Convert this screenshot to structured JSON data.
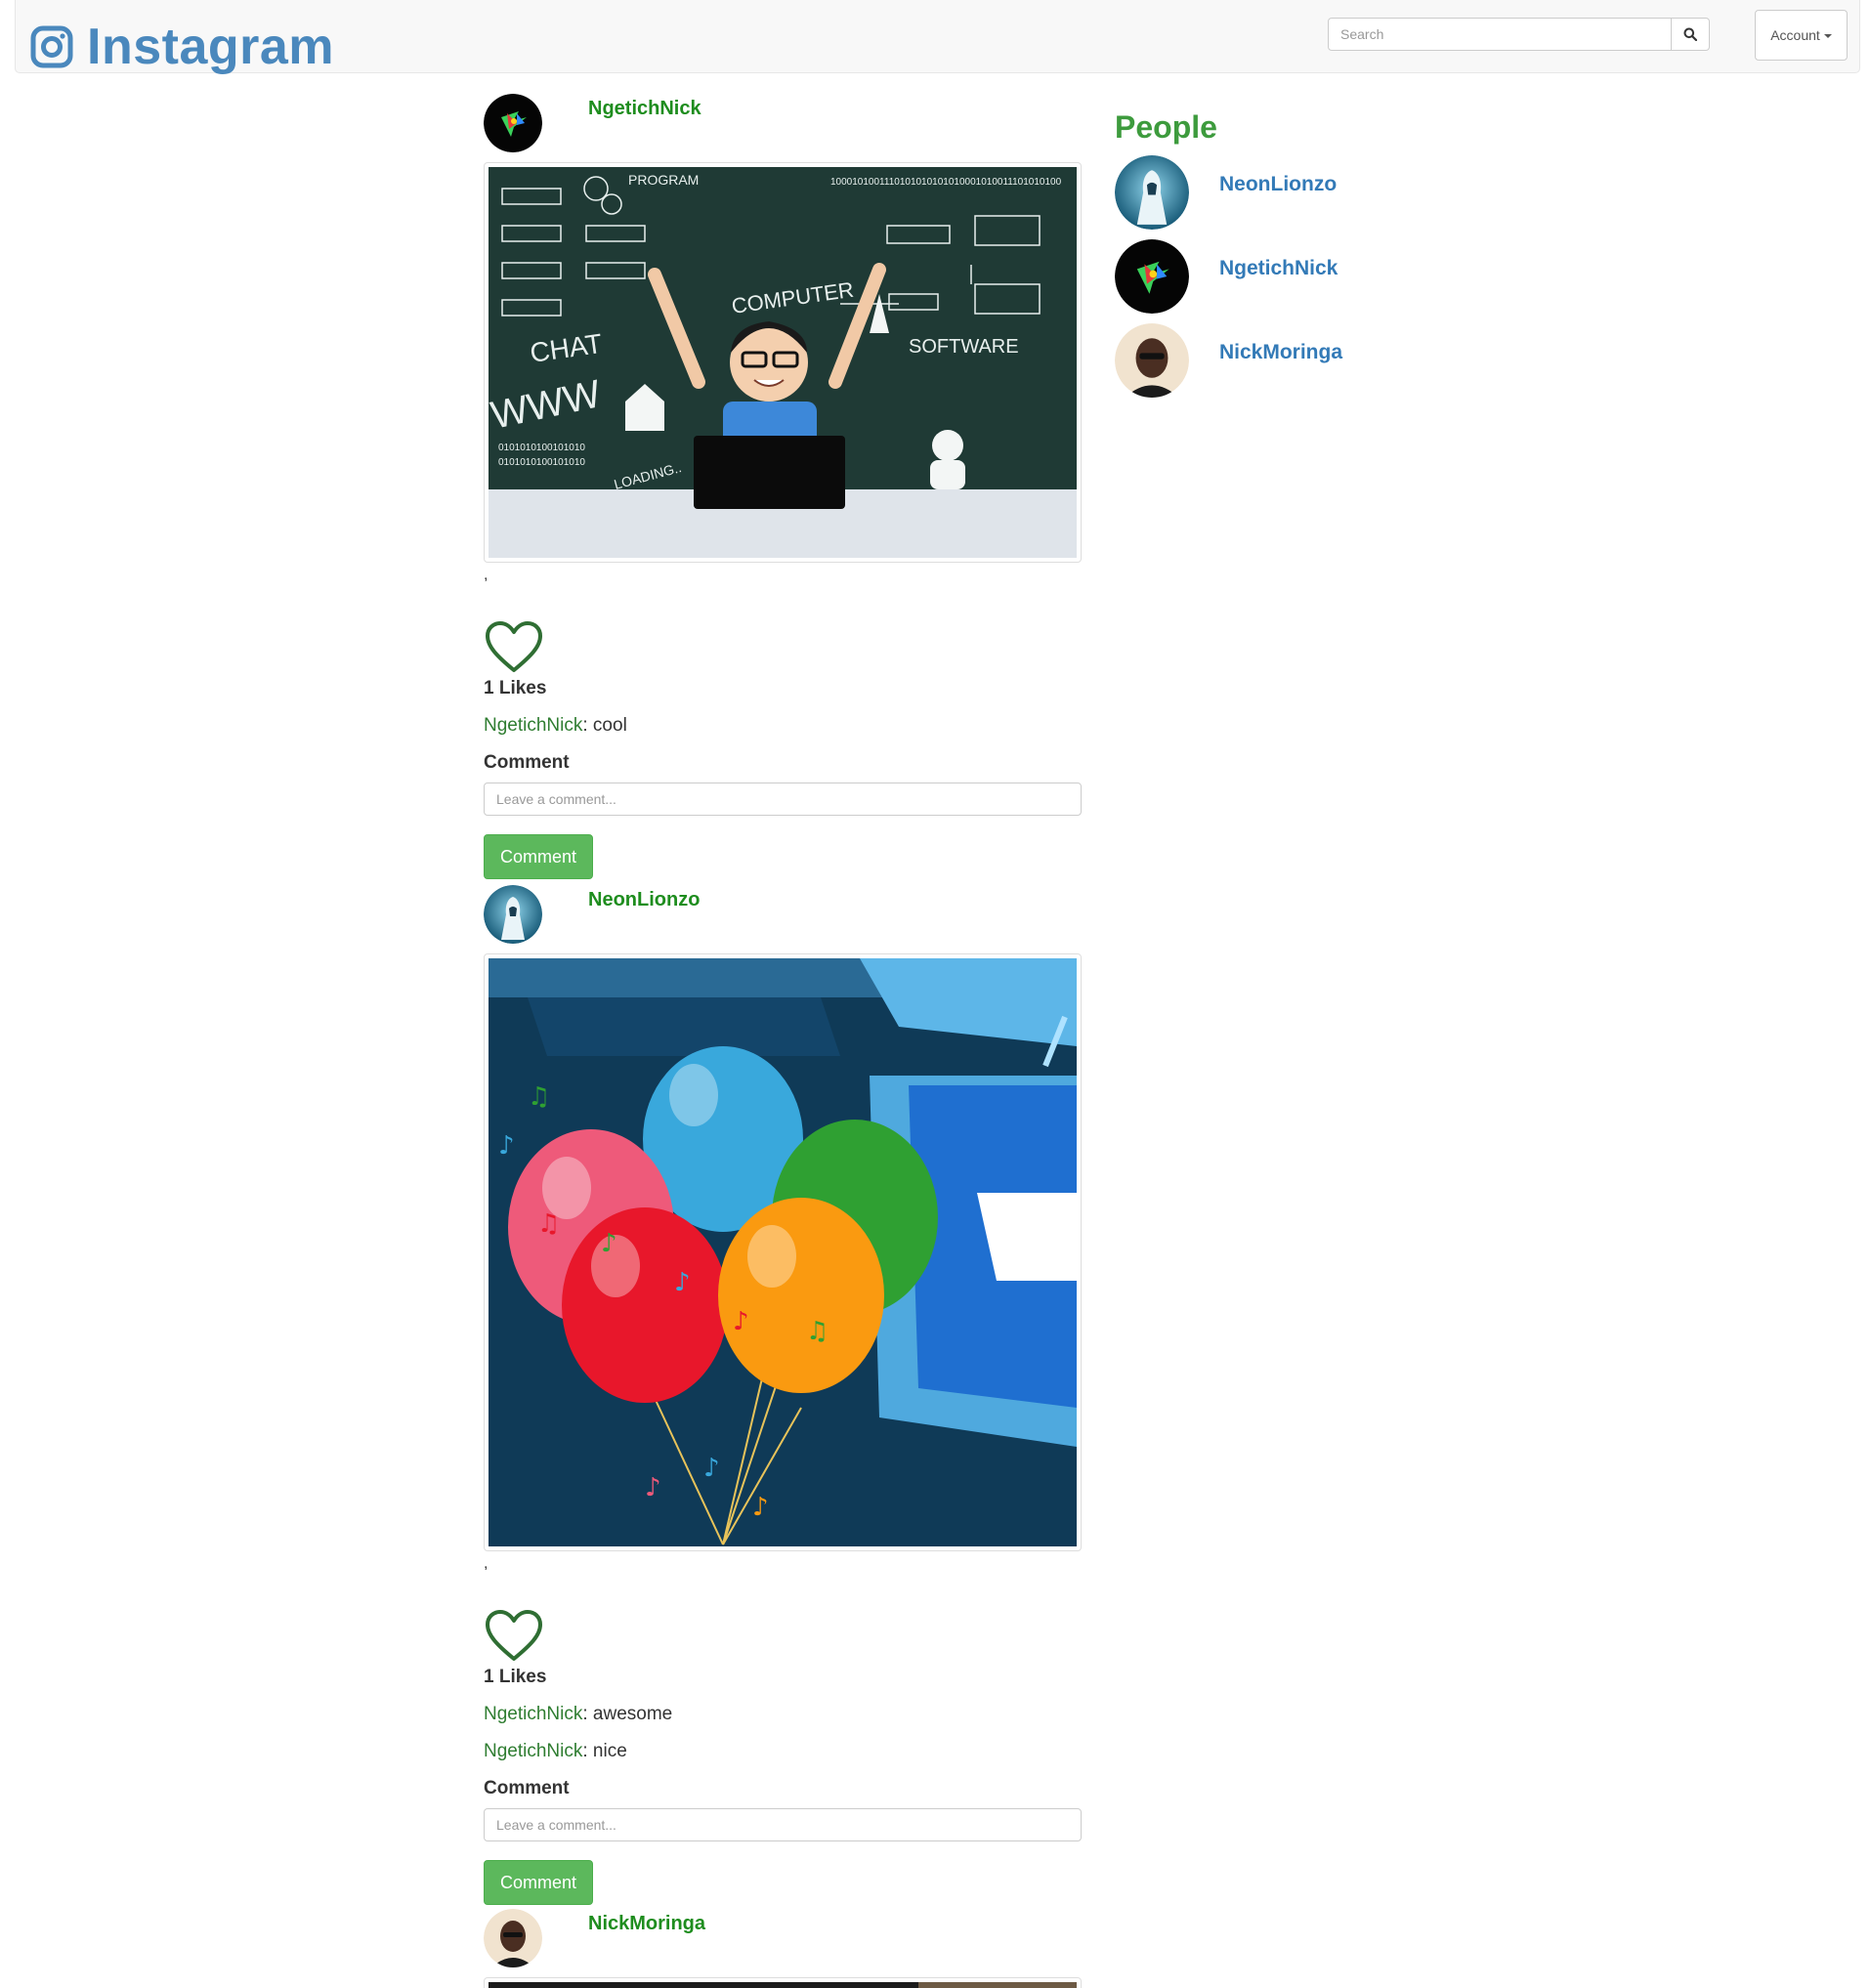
{
  "app": {
    "brand": "Instagram",
    "brand_color": "#4a88bd",
    "accent_green": "#5cb85c"
  },
  "header": {
    "search_placeholder": "Search",
    "search_icon": "search-icon",
    "account_label": "Account"
  },
  "posts": [
    {
      "user": "NgetichNick",
      "image_desc_icon": "photo",
      "separator": ",",
      "likes_text": "1 Likes",
      "comments": [
        {
          "user": "NgetichNick",
          "text": ": cool"
        }
      ],
      "comment_label": "Comment",
      "comment_placeholder": "Leave a comment...",
      "comment_button": "Comment"
    },
    {
      "user": "NeonLionzo",
      "image_desc_icon": "photo",
      "separator": ",",
      "likes_text": "1 Likes",
      "comments": [
        {
          "user": "NgetichNick",
          "text": ": awesome"
        },
        {
          "user": "NgetichNick",
          "text": ": nice"
        }
      ],
      "comment_label": "Comment",
      "comment_placeholder": "Leave a comment...",
      "comment_button": "Comment"
    },
    {
      "user": "NickMoringa"
    }
  ],
  "people": {
    "title": "People",
    "list": [
      {
        "name": "NeonLionzo"
      },
      {
        "name": "NgetichNick"
      },
      {
        "name": "NickMoringa"
      }
    ]
  }
}
